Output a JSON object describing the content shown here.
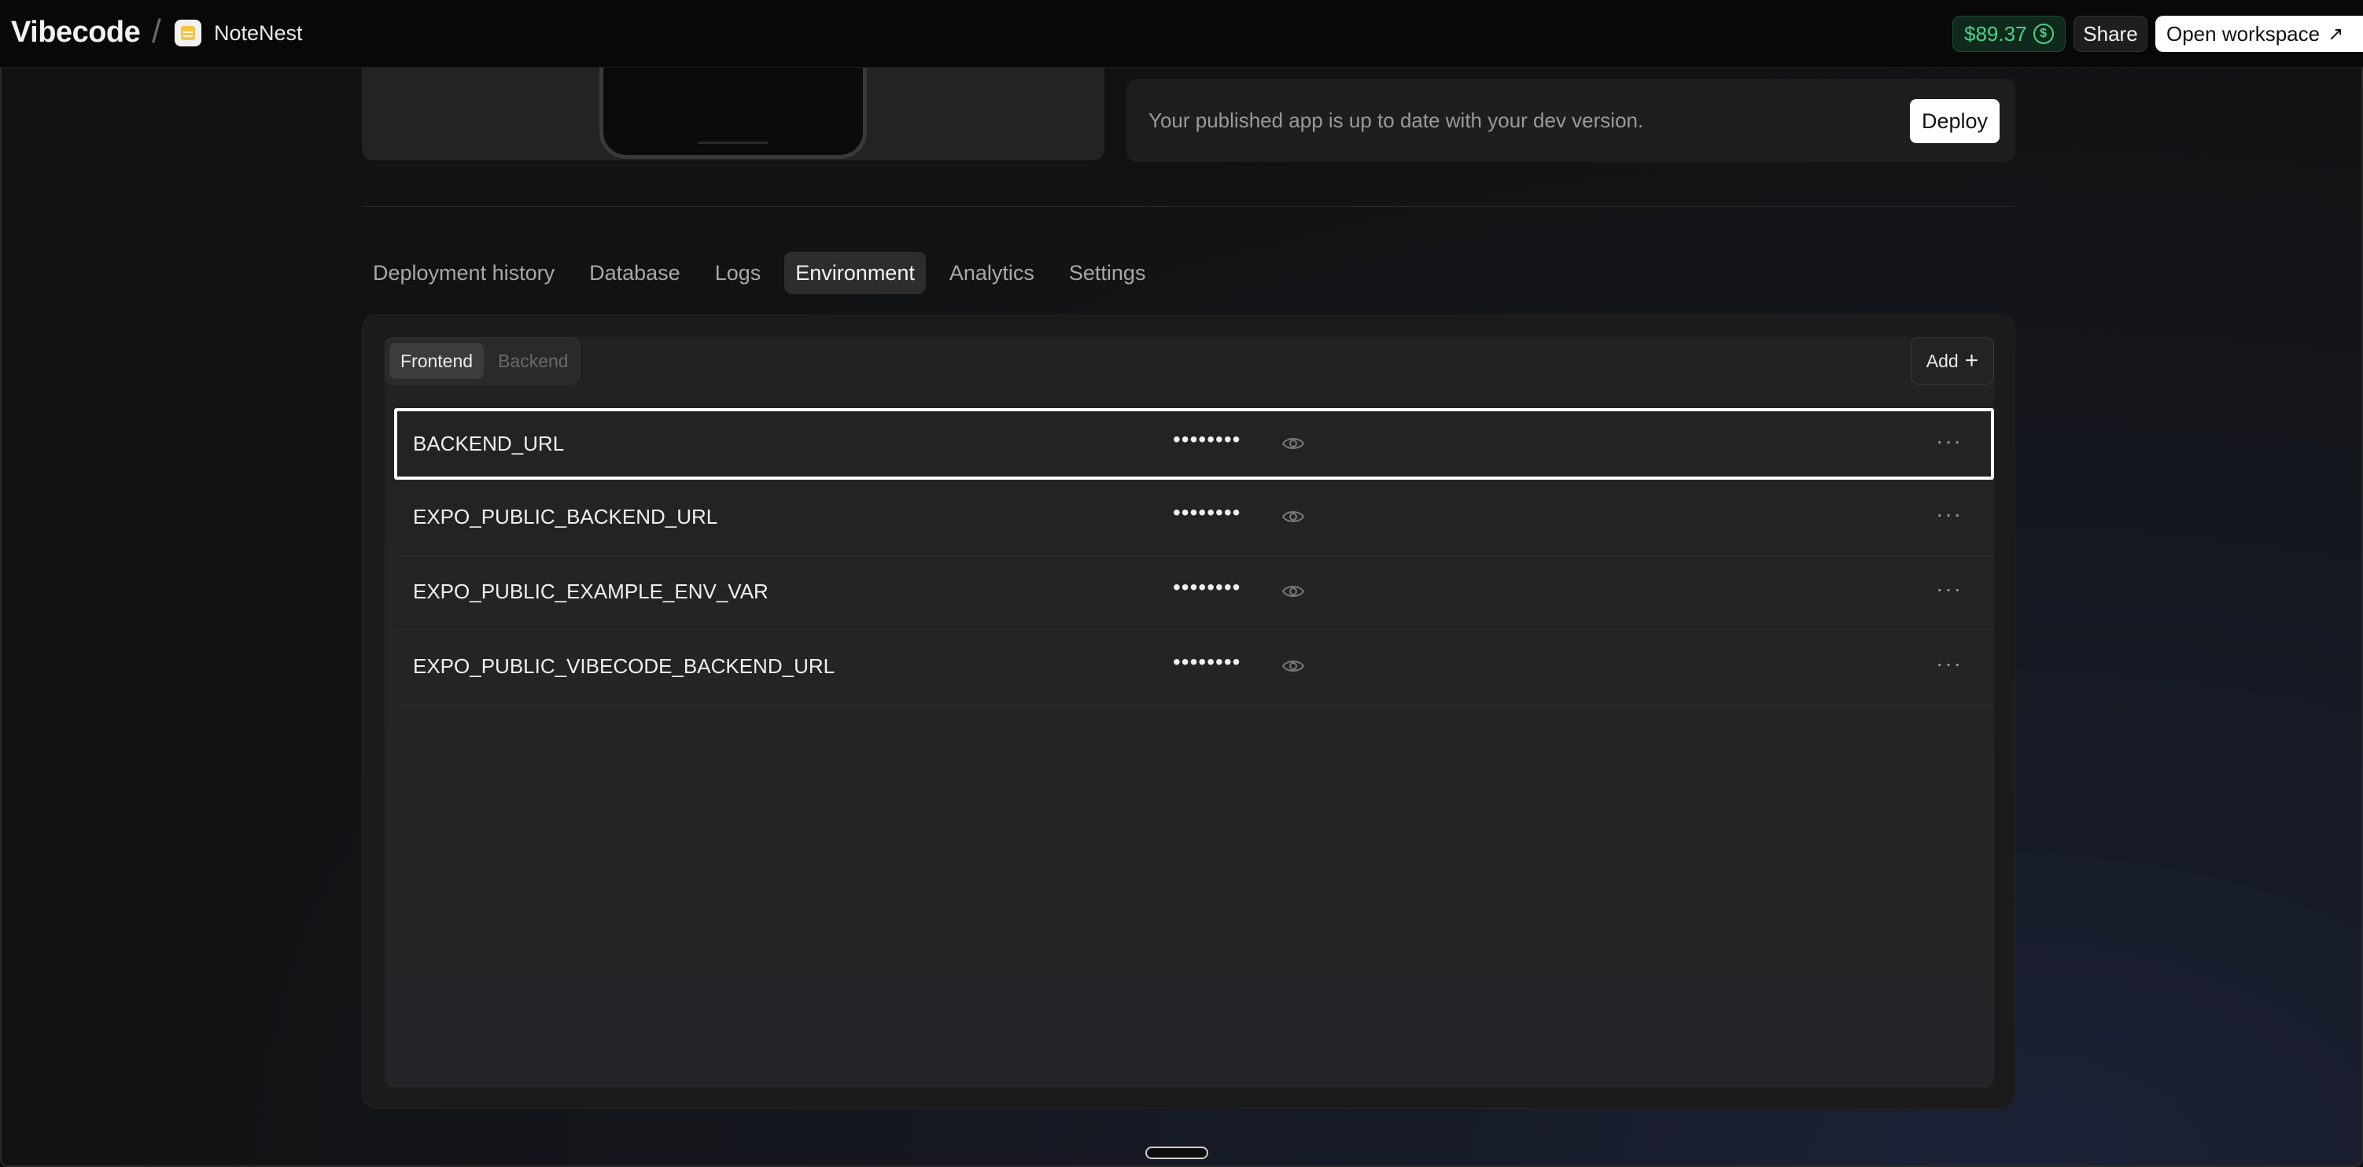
{
  "header": {
    "brand": "Vibecode",
    "separator": "/",
    "app_name": "NoteNest",
    "credits": "$89.37",
    "credits_icon": "dollar-coin-icon",
    "share_label": "Share",
    "open_workspace_label": "Open workspace",
    "open_workspace_icon": "↗"
  },
  "deploy": {
    "status_text": "Your published app is up to date with your dev version.",
    "deploy_label": "Deploy"
  },
  "tabs": [
    {
      "label": "Deployment history",
      "active": false
    },
    {
      "label": "Database",
      "active": false
    },
    {
      "label": "Logs",
      "active": false
    },
    {
      "label": "Environment",
      "active": true
    },
    {
      "label": "Analytics",
      "active": false
    },
    {
      "label": "Settings",
      "active": false
    }
  ],
  "environment": {
    "segments": [
      {
        "label": "Frontend",
        "active": true
      },
      {
        "label": "Backend",
        "active": false
      }
    ],
    "add_label": "Add",
    "add_icon": "+",
    "variables": [
      {
        "key": "BACKEND_URL",
        "value_mask": "••••••••",
        "selected": true
      },
      {
        "key": "EXPO_PUBLIC_BACKEND_URL",
        "value_mask": "••••••••",
        "selected": false
      },
      {
        "key": "EXPO_PUBLIC_EXAMPLE_ENV_VAR",
        "value_mask": "••••••••",
        "selected": false
      },
      {
        "key": "EXPO_PUBLIC_VIBECODE_BACKEND_URL",
        "value_mask": "••••••••",
        "selected": false
      }
    ],
    "more_icon": "···"
  },
  "colors": {
    "accent_green": "#4fd08a",
    "background": "#121212",
    "panel": "#1b1b1b"
  }
}
